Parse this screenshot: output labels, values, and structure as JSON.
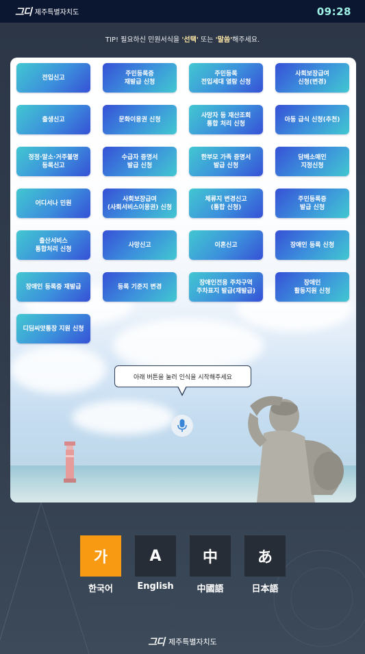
{
  "header": {
    "logo_mark": "그디",
    "logo_text": "제주특별자치도",
    "clock": "09:28"
  },
  "tip": {
    "prefix": "TIP! 필요하신 민원서식을 ",
    "select": "'선택'",
    "middle": " 또는 ",
    "speak": "'말씀'",
    "suffix": "해주세요."
  },
  "forms": [
    "전입신고",
    "주민등록증\n재발급 신청",
    "주민등록\n전입세대 열람 신청",
    "사회보장급여\n신청(변경)",
    "출생신고",
    "문화이용권 신청",
    "사망자 등 재산조회\n통합 처리 신청",
    "아동 급식 신청(추천)",
    "정정·말소·거주불명\n등록신고",
    "수급자 증명서\n발급 신청",
    "한부모 가족 증명서\n발급 신청",
    "담배소매인\n지정신청",
    "어디서나 민원",
    "사회보장급여\n(사회서비스이용권) 신청",
    "체류지 변경신고\n(통합 신청)",
    "주민등록증\n발급 신청",
    "출산서비스\n통합처리 신청",
    "사망신고",
    "이혼신고",
    "장애인 등록 신청",
    "장애인 등록증 재발급",
    "등록 기준지 변경",
    "장애인전용 주차구역\n주차표지 발급(재발급)",
    "장애인\n활동지원 신청",
    "디딤씨앗통장 지원 신청"
  ],
  "speech_bubble": "아래 버튼을 눌러 인식을 시작해주세요",
  "languages": [
    {
      "glyph": "가",
      "label": "한국어",
      "active": true
    },
    {
      "glyph": "A",
      "label": "English",
      "active": false
    },
    {
      "glyph": "中",
      "label": "中國語",
      "active": false
    },
    {
      "glyph": "あ",
      "label": "日本語",
      "active": false
    }
  ],
  "footer": {
    "logo_mark": "그디",
    "logo_text": "제주특별자치도"
  },
  "colors": {
    "accent_active_language": "#f89a12",
    "clock": "#9ff3e6",
    "button_gradient": [
      "#42c7d1",
      "#3651d6"
    ]
  },
  "icons": [
    "microphone-icon",
    "lighthouse-illustration",
    "haenyeo-statue-illustration"
  ]
}
